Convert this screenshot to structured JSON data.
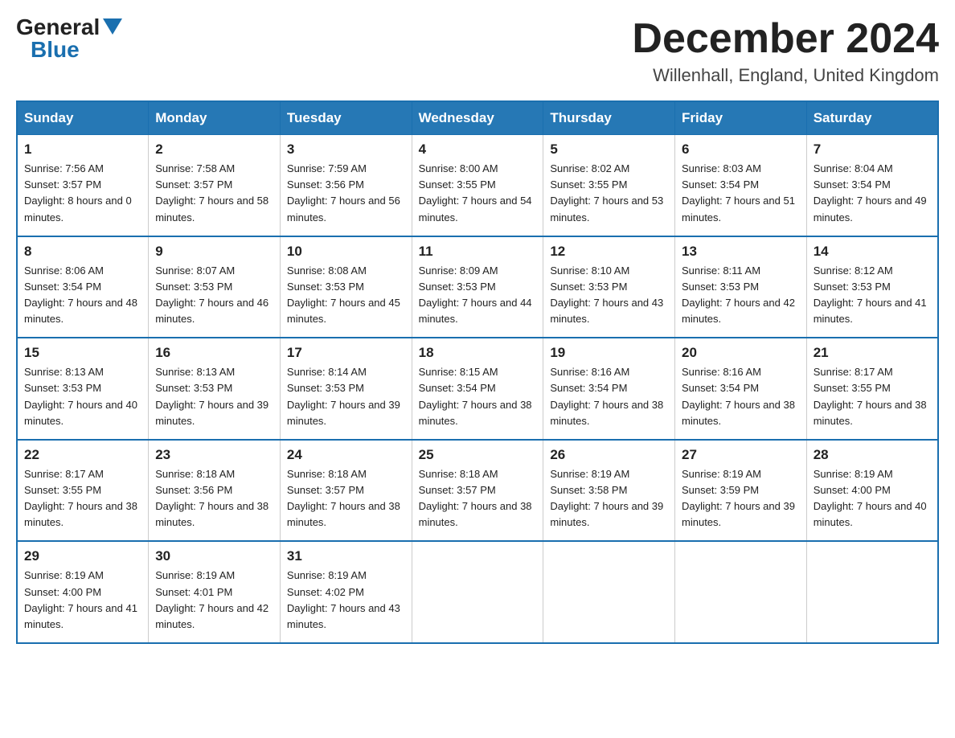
{
  "logo": {
    "general": "General",
    "blue": "Blue",
    "triangle_color": "#1a6faf"
  },
  "header": {
    "title": "December 2024",
    "subtitle": "Willenhall, England, United Kingdom"
  },
  "columns": [
    "Sunday",
    "Monday",
    "Tuesday",
    "Wednesday",
    "Thursday",
    "Friday",
    "Saturday"
  ],
  "weeks": [
    [
      {
        "day": "1",
        "sunrise": "Sunrise: 7:56 AM",
        "sunset": "Sunset: 3:57 PM",
        "daylight": "Daylight: 8 hours and 0 minutes."
      },
      {
        "day": "2",
        "sunrise": "Sunrise: 7:58 AM",
        "sunset": "Sunset: 3:57 PM",
        "daylight": "Daylight: 7 hours and 58 minutes."
      },
      {
        "day": "3",
        "sunrise": "Sunrise: 7:59 AM",
        "sunset": "Sunset: 3:56 PM",
        "daylight": "Daylight: 7 hours and 56 minutes."
      },
      {
        "day": "4",
        "sunrise": "Sunrise: 8:00 AM",
        "sunset": "Sunset: 3:55 PM",
        "daylight": "Daylight: 7 hours and 54 minutes."
      },
      {
        "day": "5",
        "sunrise": "Sunrise: 8:02 AM",
        "sunset": "Sunset: 3:55 PM",
        "daylight": "Daylight: 7 hours and 53 minutes."
      },
      {
        "day": "6",
        "sunrise": "Sunrise: 8:03 AM",
        "sunset": "Sunset: 3:54 PM",
        "daylight": "Daylight: 7 hours and 51 minutes."
      },
      {
        "day": "7",
        "sunrise": "Sunrise: 8:04 AM",
        "sunset": "Sunset: 3:54 PM",
        "daylight": "Daylight: 7 hours and 49 minutes."
      }
    ],
    [
      {
        "day": "8",
        "sunrise": "Sunrise: 8:06 AM",
        "sunset": "Sunset: 3:54 PM",
        "daylight": "Daylight: 7 hours and 48 minutes."
      },
      {
        "day": "9",
        "sunrise": "Sunrise: 8:07 AM",
        "sunset": "Sunset: 3:53 PM",
        "daylight": "Daylight: 7 hours and 46 minutes."
      },
      {
        "day": "10",
        "sunrise": "Sunrise: 8:08 AM",
        "sunset": "Sunset: 3:53 PM",
        "daylight": "Daylight: 7 hours and 45 minutes."
      },
      {
        "day": "11",
        "sunrise": "Sunrise: 8:09 AM",
        "sunset": "Sunset: 3:53 PM",
        "daylight": "Daylight: 7 hours and 44 minutes."
      },
      {
        "day": "12",
        "sunrise": "Sunrise: 8:10 AM",
        "sunset": "Sunset: 3:53 PM",
        "daylight": "Daylight: 7 hours and 43 minutes."
      },
      {
        "day": "13",
        "sunrise": "Sunrise: 8:11 AM",
        "sunset": "Sunset: 3:53 PM",
        "daylight": "Daylight: 7 hours and 42 minutes."
      },
      {
        "day": "14",
        "sunrise": "Sunrise: 8:12 AM",
        "sunset": "Sunset: 3:53 PM",
        "daylight": "Daylight: 7 hours and 41 minutes."
      }
    ],
    [
      {
        "day": "15",
        "sunrise": "Sunrise: 8:13 AM",
        "sunset": "Sunset: 3:53 PM",
        "daylight": "Daylight: 7 hours and 40 minutes."
      },
      {
        "day": "16",
        "sunrise": "Sunrise: 8:13 AM",
        "sunset": "Sunset: 3:53 PM",
        "daylight": "Daylight: 7 hours and 39 minutes."
      },
      {
        "day": "17",
        "sunrise": "Sunrise: 8:14 AM",
        "sunset": "Sunset: 3:53 PM",
        "daylight": "Daylight: 7 hours and 39 minutes."
      },
      {
        "day": "18",
        "sunrise": "Sunrise: 8:15 AM",
        "sunset": "Sunset: 3:54 PM",
        "daylight": "Daylight: 7 hours and 38 minutes."
      },
      {
        "day": "19",
        "sunrise": "Sunrise: 8:16 AM",
        "sunset": "Sunset: 3:54 PM",
        "daylight": "Daylight: 7 hours and 38 minutes."
      },
      {
        "day": "20",
        "sunrise": "Sunrise: 8:16 AM",
        "sunset": "Sunset: 3:54 PM",
        "daylight": "Daylight: 7 hours and 38 minutes."
      },
      {
        "day": "21",
        "sunrise": "Sunrise: 8:17 AM",
        "sunset": "Sunset: 3:55 PM",
        "daylight": "Daylight: 7 hours and 38 minutes."
      }
    ],
    [
      {
        "day": "22",
        "sunrise": "Sunrise: 8:17 AM",
        "sunset": "Sunset: 3:55 PM",
        "daylight": "Daylight: 7 hours and 38 minutes."
      },
      {
        "day": "23",
        "sunrise": "Sunrise: 8:18 AM",
        "sunset": "Sunset: 3:56 PM",
        "daylight": "Daylight: 7 hours and 38 minutes."
      },
      {
        "day": "24",
        "sunrise": "Sunrise: 8:18 AM",
        "sunset": "Sunset: 3:57 PM",
        "daylight": "Daylight: 7 hours and 38 minutes."
      },
      {
        "day": "25",
        "sunrise": "Sunrise: 8:18 AM",
        "sunset": "Sunset: 3:57 PM",
        "daylight": "Daylight: 7 hours and 38 minutes."
      },
      {
        "day": "26",
        "sunrise": "Sunrise: 8:19 AM",
        "sunset": "Sunset: 3:58 PM",
        "daylight": "Daylight: 7 hours and 39 minutes."
      },
      {
        "day": "27",
        "sunrise": "Sunrise: 8:19 AM",
        "sunset": "Sunset: 3:59 PM",
        "daylight": "Daylight: 7 hours and 39 minutes."
      },
      {
        "day": "28",
        "sunrise": "Sunrise: 8:19 AM",
        "sunset": "Sunset: 4:00 PM",
        "daylight": "Daylight: 7 hours and 40 minutes."
      }
    ],
    [
      {
        "day": "29",
        "sunrise": "Sunrise: 8:19 AM",
        "sunset": "Sunset: 4:00 PM",
        "daylight": "Daylight: 7 hours and 41 minutes."
      },
      {
        "day": "30",
        "sunrise": "Sunrise: 8:19 AM",
        "sunset": "Sunset: 4:01 PM",
        "daylight": "Daylight: 7 hours and 42 minutes."
      },
      {
        "day": "31",
        "sunrise": "Sunrise: 8:19 AM",
        "sunset": "Sunset: 4:02 PM",
        "daylight": "Daylight: 7 hours and 43 minutes."
      },
      null,
      null,
      null,
      null
    ]
  ]
}
